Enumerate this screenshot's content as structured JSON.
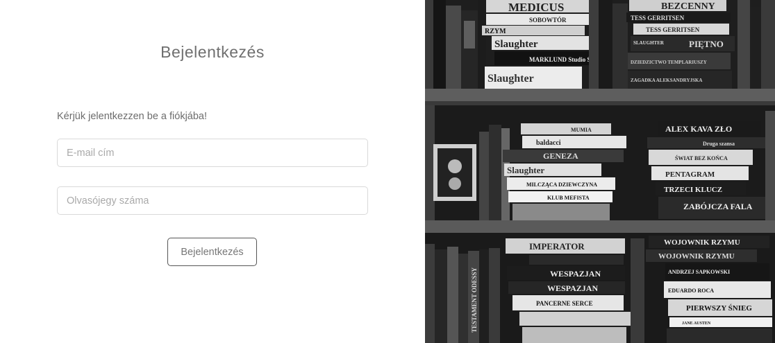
{
  "login": {
    "title": "Bejelentkezés",
    "prompt": "Kérjük jelentkezzen be a fiókjába!",
    "email_placeholder": "E-mail cím",
    "card_placeholder": "Olvasójegy száma",
    "submit_label": "Bejelentkezés"
  },
  "photo": {
    "spines": {
      "s1": "MEDICUS",
      "s2": "BEZCENNY",
      "s3": "SOBOWTÓR",
      "s4": "TESS GERRITSEN",
      "s5": "TESS GERRITSEN",
      "s6": "RZYM",
      "s7": "Slaughter",
      "s8": "SLAUGHTER",
      "s9": "PIĘTNO",
      "s10": "MARKLUND Studio Sex",
      "s11": "DZIEDZICTWO TEMPLARIUSZY",
      "s12": "Slaughter",
      "s13": "ZAGADKA ALEKSANDRYJSKA",
      "s14": "MUMIA",
      "s15": "ALEX KAVA ZŁO",
      "s16": "baldacci",
      "s17": "Druga szansa",
      "s18": "GENEZA",
      "s19": "ŚWIAT BEZ KOŃCA",
      "s20": "Slaughter",
      "s21": "PENTAGRAM",
      "s22": "MILCZĄCA DZIEWCZYNA",
      "s23": "TRZECI KLUCZ",
      "s24": "KLUB MEFISTA",
      "s25": "ZABÓJCZA FALA",
      "s26": "IMPERATOR",
      "s27": "WOJOWNIK RZYMU",
      "s28": "WOJOWNIK RZYMU",
      "s29": "WESPAZJAN",
      "s30": "ANDRZEJ SAPKOWSKI",
      "s31": "WESPAZJAN",
      "s32": "EDUARDO ROCA",
      "s33": "PANCERNE SERCE",
      "s34": "PIERWSZY ŚNIEG",
      "s35": "TESTAMENT ODESSY",
      "s36": "JANE AUSTEN"
    }
  }
}
